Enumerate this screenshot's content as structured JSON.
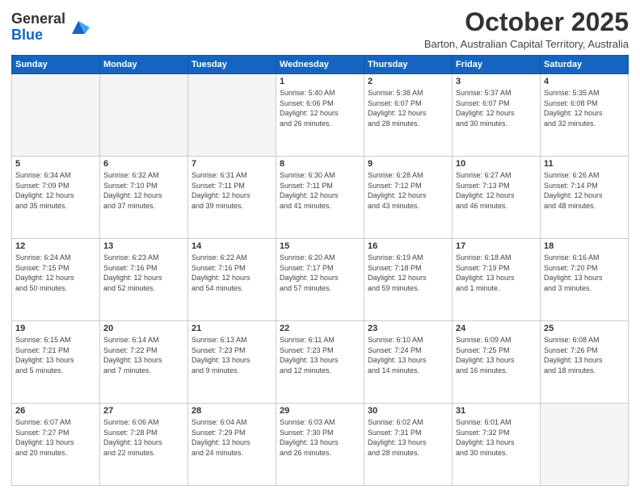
{
  "header": {
    "logo_general": "General",
    "logo_blue": "Blue",
    "month_title": "October 2025",
    "subtitle": "Barton, Australian Capital Territory, Australia"
  },
  "weekdays": [
    "Sunday",
    "Monday",
    "Tuesday",
    "Wednesday",
    "Thursday",
    "Friday",
    "Saturday"
  ],
  "weeks": [
    [
      {
        "day": "",
        "info": ""
      },
      {
        "day": "",
        "info": ""
      },
      {
        "day": "",
        "info": ""
      },
      {
        "day": "1",
        "info": "Sunrise: 5:40 AM\nSunset: 6:06 PM\nDaylight: 12 hours\nand 26 minutes."
      },
      {
        "day": "2",
        "info": "Sunrise: 5:38 AM\nSunset: 6:07 PM\nDaylight: 12 hours\nand 28 minutes."
      },
      {
        "day": "3",
        "info": "Sunrise: 5:37 AM\nSunset: 6:07 PM\nDaylight: 12 hours\nand 30 minutes."
      },
      {
        "day": "4",
        "info": "Sunrise: 5:35 AM\nSunset: 6:08 PM\nDaylight: 12 hours\nand 32 minutes."
      }
    ],
    [
      {
        "day": "5",
        "info": "Sunrise: 6:34 AM\nSunset: 7:09 PM\nDaylight: 12 hours\nand 35 minutes."
      },
      {
        "day": "6",
        "info": "Sunrise: 6:32 AM\nSunset: 7:10 PM\nDaylight: 12 hours\nand 37 minutes."
      },
      {
        "day": "7",
        "info": "Sunrise: 6:31 AM\nSunset: 7:11 PM\nDaylight: 12 hours\nand 39 minutes."
      },
      {
        "day": "8",
        "info": "Sunrise: 6:30 AM\nSunset: 7:11 PM\nDaylight: 12 hours\nand 41 minutes."
      },
      {
        "day": "9",
        "info": "Sunrise: 6:28 AM\nSunset: 7:12 PM\nDaylight: 12 hours\nand 43 minutes."
      },
      {
        "day": "10",
        "info": "Sunrise: 6:27 AM\nSunset: 7:13 PM\nDaylight: 12 hours\nand 46 minutes."
      },
      {
        "day": "11",
        "info": "Sunrise: 6:26 AM\nSunset: 7:14 PM\nDaylight: 12 hours\nand 48 minutes."
      }
    ],
    [
      {
        "day": "12",
        "info": "Sunrise: 6:24 AM\nSunset: 7:15 PM\nDaylight: 12 hours\nand 50 minutes."
      },
      {
        "day": "13",
        "info": "Sunrise: 6:23 AM\nSunset: 7:16 PM\nDaylight: 12 hours\nand 52 minutes."
      },
      {
        "day": "14",
        "info": "Sunrise: 6:22 AM\nSunset: 7:16 PM\nDaylight: 12 hours\nand 54 minutes."
      },
      {
        "day": "15",
        "info": "Sunrise: 6:20 AM\nSunset: 7:17 PM\nDaylight: 12 hours\nand 57 minutes."
      },
      {
        "day": "16",
        "info": "Sunrise: 6:19 AM\nSunset: 7:18 PM\nDaylight: 12 hours\nand 59 minutes."
      },
      {
        "day": "17",
        "info": "Sunrise: 6:18 AM\nSunset: 7:19 PM\nDaylight: 13 hours\nand 1 minute."
      },
      {
        "day": "18",
        "info": "Sunrise: 6:16 AM\nSunset: 7:20 PM\nDaylight: 13 hours\nand 3 minutes."
      }
    ],
    [
      {
        "day": "19",
        "info": "Sunrise: 6:15 AM\nSunset: 7:21 PM\nDaylight: 13 hours\nand 5 minutes."
      },
      {
        "day": "20",
        "info": "Sunrise: 6:14 AM\nSunset: 7:22 PM\nDaylight: 13 hours\nand 7 minutes."
      },
      {
        "day": "21",
        "info": "Sunrise: 6:13 AM\nSunset: 7:23 PM\nDaylight: 13 hours\nand 9 minutes."
      },
      {
        "day": "22",
        "info": "Sunrise: 6:11 AM\nSunset: 7:23 PM\nDaylight: 13 hours\nand 12 minutes."
      },
      {
        "day": "23",
        "info": "Sunrise: 6:10 AM\nSunset: 7:24 PM\nDaylight: 13 hours\nand 14 minutes."
      },
      {
        "day": "24",
        "info": "Sunrise: 6:09 AM\nSunset: 7:25 PM\nDaylight: 13 hours\nand 16 minutes."
      },
      {
        "day": "25",
        "info": "Sunrise: 6:08 AM\nSunset: 7:26 PM\nDaylight: 13 hours\nand 18 minutes."
      }
    ],
    [
      {
        "day": "26",
        "info": "Sunrise: 6:07 AM\nSunset: 7:27 PM\nDaylight: 13 hours\nand 20 minutes."
      },
      {
        "day": "27",
        "info": "Sunrise: 6:06 AM\nSunset: 7:28 PM\nDaylight: 13 hours\nand 22 minutes."
      },
      {
        "day": "28",
        "info": "Sunrise: 6:04 AM\nSunset: 7:29 PM\nDaylight: 13 hours\nand 24 minutes."
      },
      {
        "day": "29",
        "info": "Sunrise: 6:03 AM\nSunset: 7:30 PM\nDaylight: 13 hours\nand 26 minutes."
      },
      {
        "day": "30",
        "info": "Sunrise: 6:02 AM\nSunset: 7:31 PM\nDaylight: 13 hours\nand 28 minutes."
      },
      {
        "day": "31",
        "info": "Sunrise: 6:01 AM\nSunset: 7:32 PM\nDaylight: 13 hours\nand 30 minutes."
      },
      {
        "day": "",
        "info": ""
      }
    ]
  ]
}
